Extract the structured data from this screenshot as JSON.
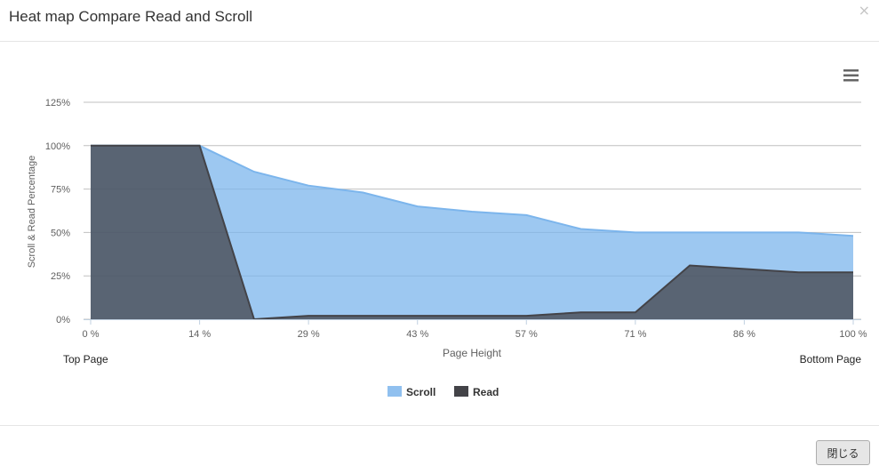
{
  "modal": {
    "title": "Heat map Compare Read and Scroll",
    "close_glyph": "×",
    "close_button_label": "閉じる",
    "menu_icon": "hamburger-menu-icon"
  },
  "chart_data": {
    "type": "area",
    "title": "",
    "xlabel": "Page Height",
    "ylabel": "Scroll & Read Percentage",
    "x": [
      0,
      7.14,
      14.29,
      21.43,
      28.57,
      35.71,
      42.86,
      50,
      57.14,
      64.29,
      71.43,
      78.57,
      85.71,
      92.86,
      100
    ],
    "x_tick_labels": [
      "0 %",
      "14 %",
      "29 %",
      "43 %",
      "57 %",
      "71 %",
      "86 %",
      "100 %"
    ],
    "x_tick_values": [
      0,
      14.29,
      28.57,
      42.86,
      57.14,
      71.43,
      85.71,
      100
    ],
    "y_tick_labels": [
      "0%",
      "25%",
      "50%",
      "75%",
      "100%",
      "125%"
    ],
    "ylim": [
      0,
      125
    ],
    "series": [
      {
        "name": "Scroll",
        "color": "#7cb5ec",
        "values": [
          100,
          100,
          100,
          85,
          77,
          73,
          65,
          62,
          60,
          52,
          50,
          50,
          50,
          50,
          48
        ]
      },
      {
        "name": "Read",
        "color": "#434348",
        "values": [
          100,
          100,
          100,
          0,
          2,
          2,
          2,
          2,
          2,
          4,
          4,
          31,
          29,
          27,
          27
        ]
      }
    ],
    "grid": true,
    "legend_position": "bottom-center",
    "left_caption": "Top Page",
    "right_caption": "Bottom Page"
  }
}
